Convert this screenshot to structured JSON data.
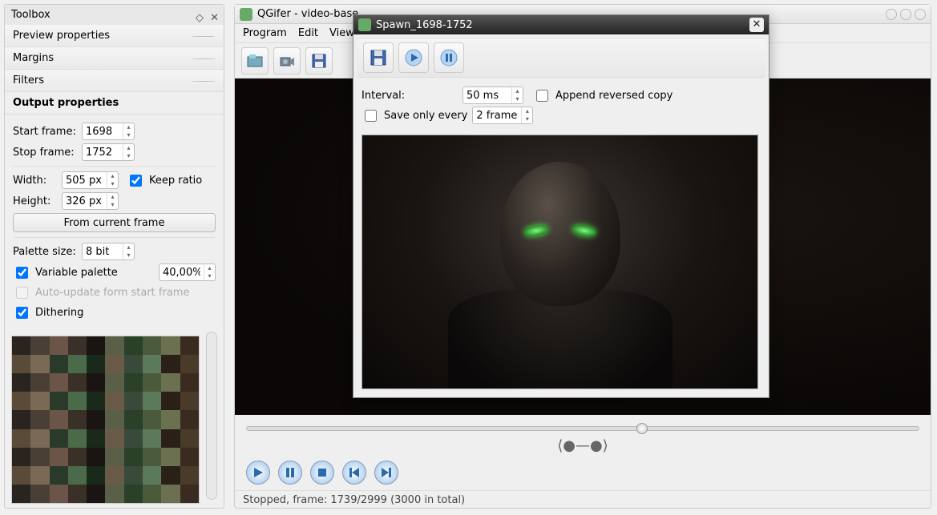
{
  "toolbox": {
    "title": "Toolbox",
    "tabs": {
      "preview": "Preview properties",
      "margins": "Margins",
      "filters": "Filters"
    },
    "output_title": "Output properties",
    "start_frame_label": "Start frame:",
    "start_frame": "1698",
    "stop_frame_label": "Stop frame:",
    "stop_frame": "1752",
    "width_label": "Width:",
    "width": "505 px",
    "height_label": "Height:",
    "height": "326 px",
    "keep_ratio": "Keep ratio",
    "from_current": "From current frame",
    "palette_label": "Palette size:",
    "palette_value": "8 bit",
    "variable_palette": "Variable palette",
    "variable_value": "40,00%",
    "auto_update": "Auto-update form start frame",
    "dithering": "Dithering"
  },
  "main": {
    "title": "QGifer - video-base",
    "menu": {
      "program": "Program",
      "edit": "Edit",
      "view": "View"
    },
    "status": "Stopped, frame: 1739/2999 (3000 in total)"
  },
  "dialog": {
    "title": "Spawn_1698-1752",
    "interval_label": "Interval:",
    "interval_value": "50 ms",
    "append_reversed": "Append reversed copy",
    "save_only_label": "Save only every",
    "save_only_value": "2 frame"
  }
}
